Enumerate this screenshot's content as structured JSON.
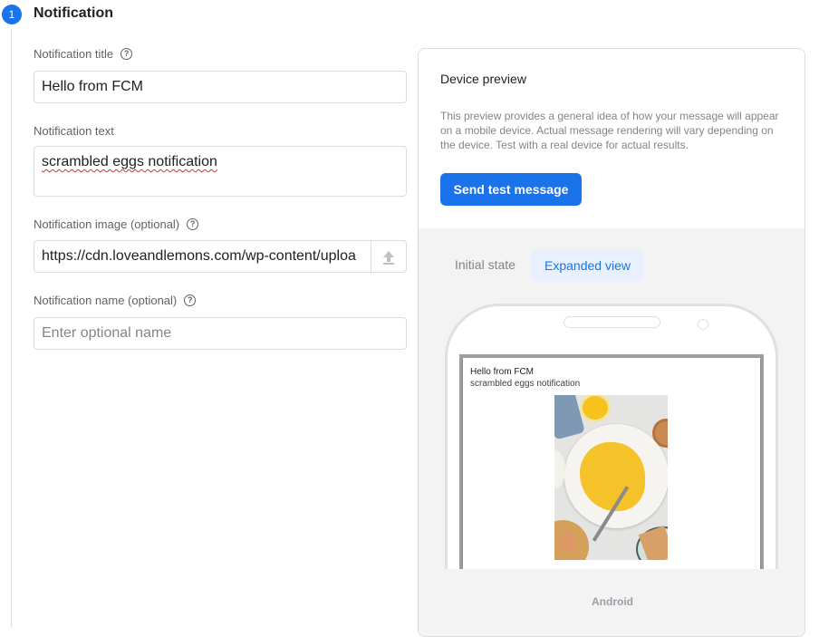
{
  "section": {
    "step": "1",
    "title": "Notification"
  },
  "form": {
    "title_label": "Notification title",
    "title_value": "Hello from FCM",
    "text_label": "Notification text",
    "text_value": "scrambled eggs notification",
    "image_label": "Notification image (optional)",
    "image_value": "https://cdn.loveandlemons.com/wp-content/uploa",
    "name_label": "Notification name (optional)",
    "name_placeholder": "Enter optional name",
    "help_glyph": "?"
  },
  "preview": {
    "title": "Device preview",
    "description": "This preview provides a general idea of how your message will appear on a mobile device. Actual message rendering will vary depending on the device. Test with a real device for actual results.",
    "send_button": "Send test message",
    "tabs": [
      {
        "label": "Initial state",
        "active": false
      },
      {
        "label": "Expanded view",
        "active": true
      }
    ],
    "notification": {
      "title": "Hello from FCM",
      "body": "scrambled eggs notification"
    },
    "platform": "Android"
  },
  "colors": {
    "accent": "#1a73e8",
    "active_tab_bg": "#e8f0fe"
  }
}
